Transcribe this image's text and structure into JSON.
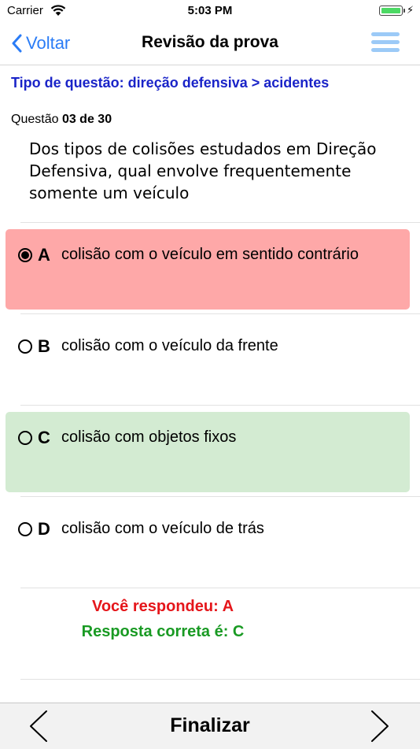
{
  "status": {
    "carrier": "Carrier",
    "time": "5:03 PM",
    "battery_level": 1.0
  },
  "nav": {
    "back_label": "Voltar",
    "title": "Revisão da prova",
    "accent": "#2a7cf6"
  },
  "question": {
    "category": "Tipo de questão: direção defensiva > acidentes",
    "number_prefix": "Questão",
    "number": "03 de 30",
    "text": "Dos tipos de colisões estudados em Direção Defensiva, qual envolve frequentemente somente um veículo"
  },
  "options": [
    {
      "letter": "A",
      "text": "colisão com o veículo em sentido contrário",
      "selected": true,
      "status": "wrong",
      "color": "#fea8a8"
    },
    {
      "letter": "B",
      "text": "colisão com o veículo da frente",
      "selected": false,
      "status": "none"
    },
    {
      "letter": "C",
      "text": "colisão com objetos fixos",
      "selected": false,
      "status": "correct",
      "color": "#d3ebd2"
    },
    {
      "letter": "D",
      "text": "colisão com o veículo de trás",
      "selected": false,
      "status": "none"
    }
  ],
  "result": {
    "answered": "Você respondeu: A",
    "answered_color": "#e5161b",
    "correct": "Resposta correta é: C",
    "correct_color": "#199a23"
  },
  "toolbar": {
    "finish_label": "Finalizar",
    "prev_icon": "chevron-left-icon",
    "next_icon": "chevron-right-icon"
  }
}
